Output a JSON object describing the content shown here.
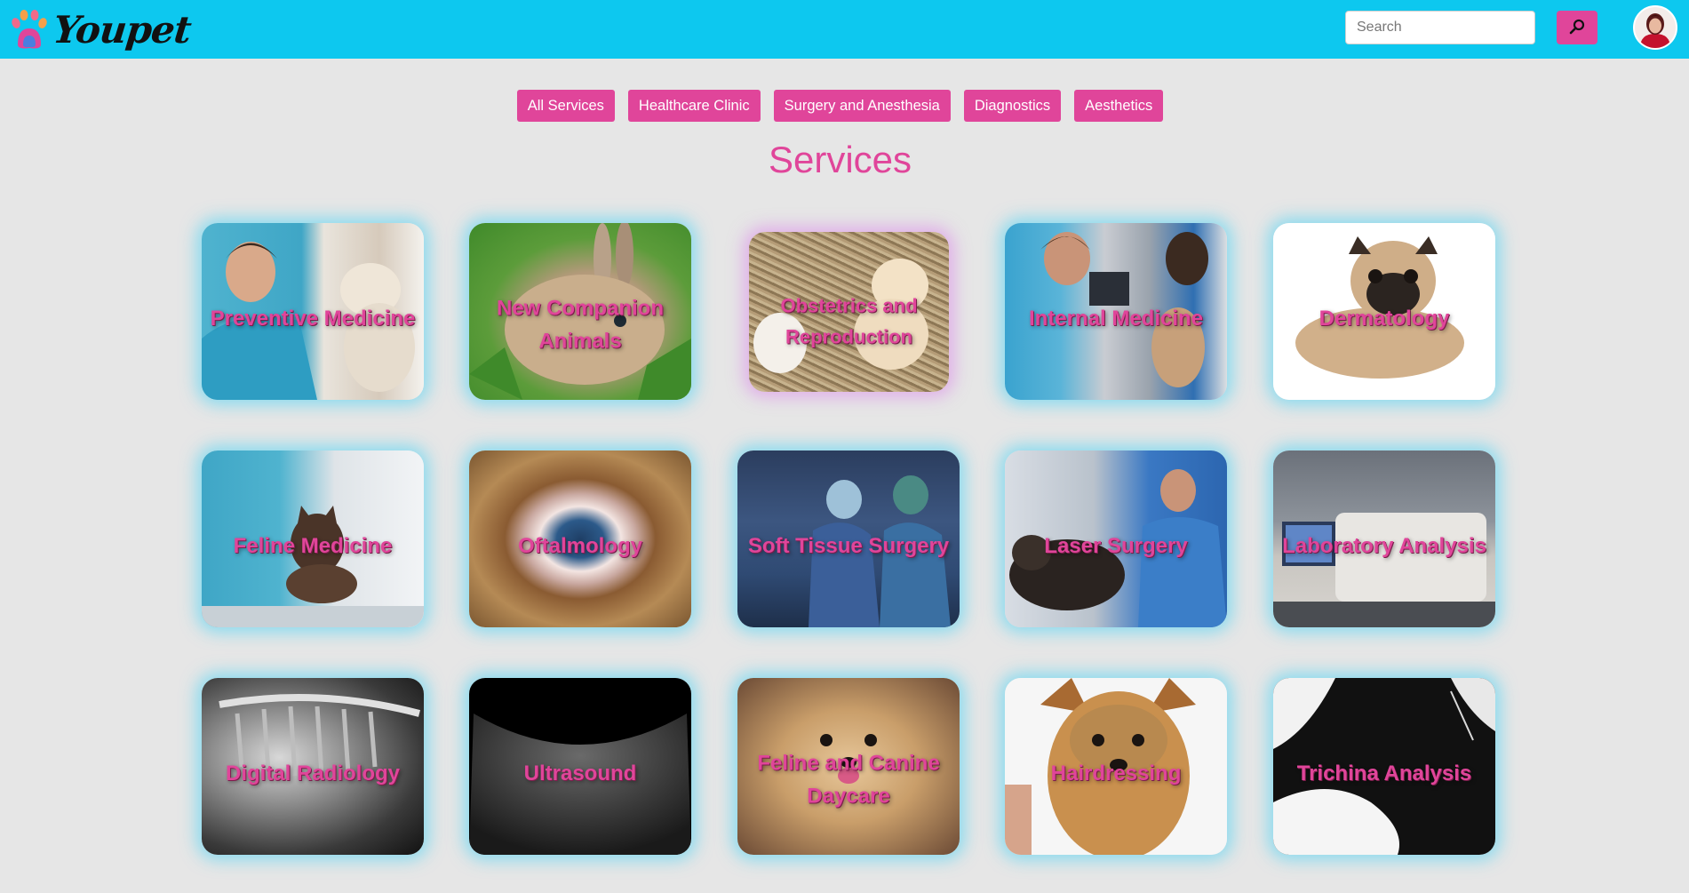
{
  "brand": {
    "name": "Youpet"
  },
  "search": {
    "placeholder": "Search"
  },
  "filters": [
    "All Services",
    "Healthcare Clinic",
    "Surgery and Anesthesia",
    "Diagnostics",
    "Aesthetics"
  ],
  "page_title": "Services",
  "services": [
    {
      "title": "Preventive Medicine",
      "icon": "vet-with-dog-photo"
    },
    {
      "title": "New Companion Animals",
      "icon": "rabbit-photo"
    },
    {
      "title": "Obstetrics and Reproduction",
      "icon": "puppies-in-hay-photo"
    },
    {
      "title": "Internal Medicine",
      "icon": "ultrasound-exam-photo"
    },
    {
      "title": "Dermatology",
      "icon": "pug-photo"
    },
    {
      "title": "Feline Medicine",
      "icon": "vet-with-kitten-photo"
    },
    {
      "title": "Oftalmology",
      "icon": "animal-eye-photo"
    },
    {
      "title": "Soft Tissue Surgery",
      "icon": "operating-room-photo"
    },
    {
      "title": "Laser Surgery",
      "icon": "laser-surgery-photo"
    },
    {
      "title": "Laboratory Analysis",
      "icon": "lab-machine-photo"
    },
    {
      "title": "Digital Radiology",
      "icon": "xray-photo"
    },
    {
      "title": "Ultrasound",
      "icon": "ultrasound-scan-photo"
    },
    {
      "title": "Feline and Canine Daycare",
      "icon": "pomeranian-photo"
    },
    {
      "title": "Hairdressing",
      "icon": "yorkshire-photo"
    },
    {
      "title": "Trichina Analysis",
      "icon": "black-white-fur-photo"
    }
  ],
  "colors": {
    "navbar": "#0dc8ef",
    "accent": "#e0459a",
    "background": "#e6e6e6",
    "glow": "#40d2f5"
  }
}
